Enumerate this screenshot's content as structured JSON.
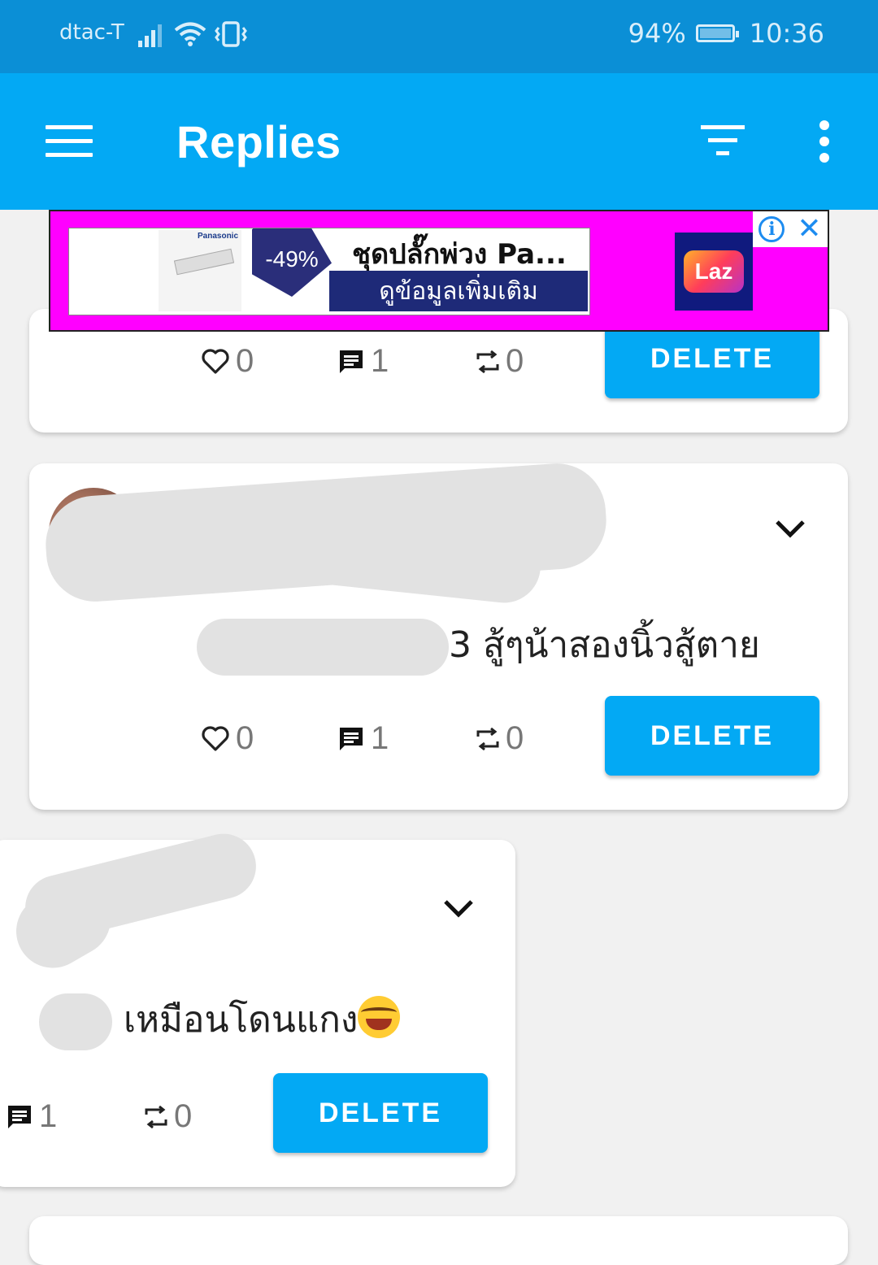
{
  "status_bar": {
    "carrier": "dtac-T",
    "battery": "94%",
    "time": "10:36"
  },
  "app_bar": {
    "title": "Replies"
  },
  "ad": {
    "brand": "Panasonic",
    "discount": "-49%",
    "title": "ชุดปลั๊กพ่วง Pa...",
    "cta": "ดูข้อมูลเพิ่มเติม",
    "logo_text": "Laz"
  },
  "cards": [
    {
      "likes": "0",
      "comments": "1",
      "retweets": "0",
      "delete_label": "DELETE"
    },
    {
      "text": "3 สู้ๆน้าสองนิ้วสู้ตาย",
      "likes": "0",
      "comments": "1",
      "retweets": "0",
      "delete_label": "DELETE"
    },
    {
      "text": "เหมือนโดนแกง",
      "comments": "1",
      "retweets": "0",
      "delete_label": "DELETE"
    }
  ],
  "colors": {
    "status_bar": "#0b8fd6",
    "app_bar": "#03a9f4",
    "button": "#03a9f4",
    "ad_background": "#ff00ff"
  }
}
